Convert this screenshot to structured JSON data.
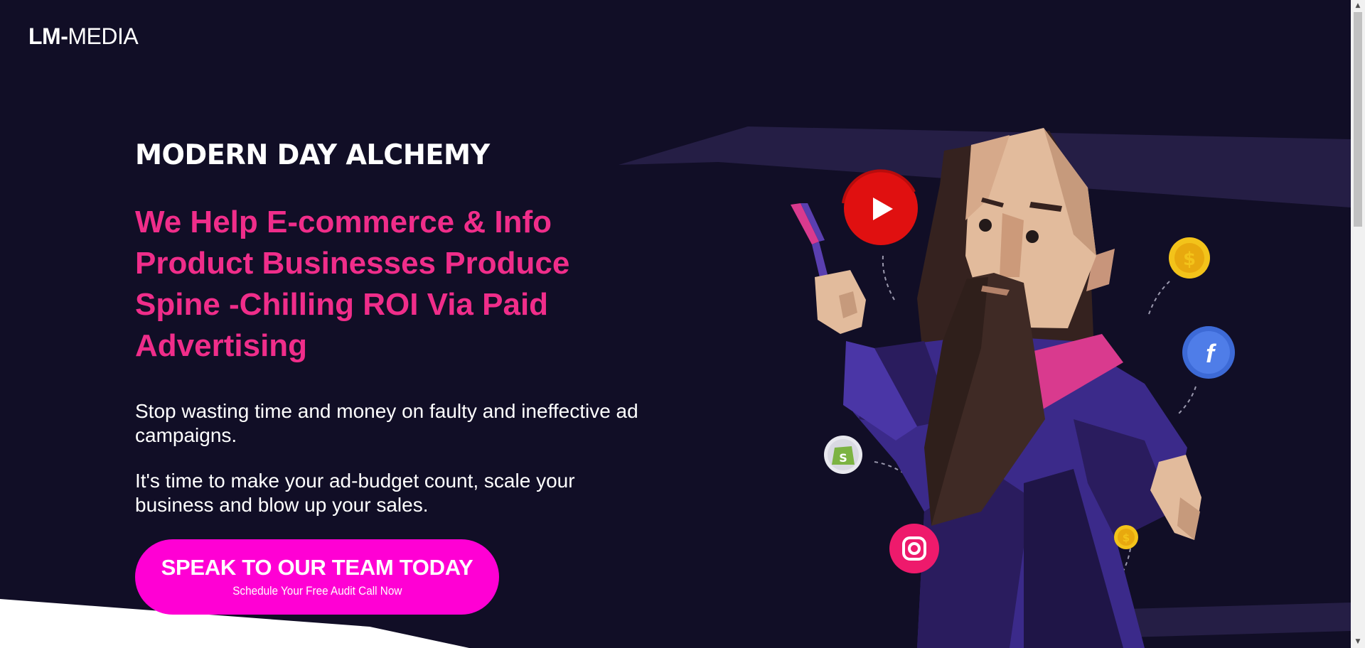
{
  "header": {
    "logo_bold": "LM-",
    "logo_light": "MEDIA"
  },
  "hero": {
    "eyebrow": "MODERN DAY ALCHEMY",
    "headline": "We Help E-commerce & Info Product Businesses Produce Spine -Chilling ROI Via Paid Advertising",
    "paragraph1": "Stop wasting time and money on faulty and ineffective ad campaigns.",
    "paragraph2": "It's time to make your ad-budget count, scale your business and blow up your sales.",
    "cta": {
      "label": "SPEAK TO OUR TEAM TODAY",
      "sublabel": "Schedule Your Free Audit Call Now"
    }
  },
  "illustration": {
    "icons": [
      "youtube-icon",
      "coin-icon",
      "facebook-icon",
      "shopify-icon",
      "instagram-icon"
    ],
    "facebook_glyph": "f",
    "shopify_glyph": "S",
    "coin_glyph": "$"
  },
  "colors": {
    "background": "#110e26",
    "accent_pink": "#f02d8a",
    "cta_magenta": "#ff00d4",
    "robe_purple": "#3b2a8a"
  }
}
